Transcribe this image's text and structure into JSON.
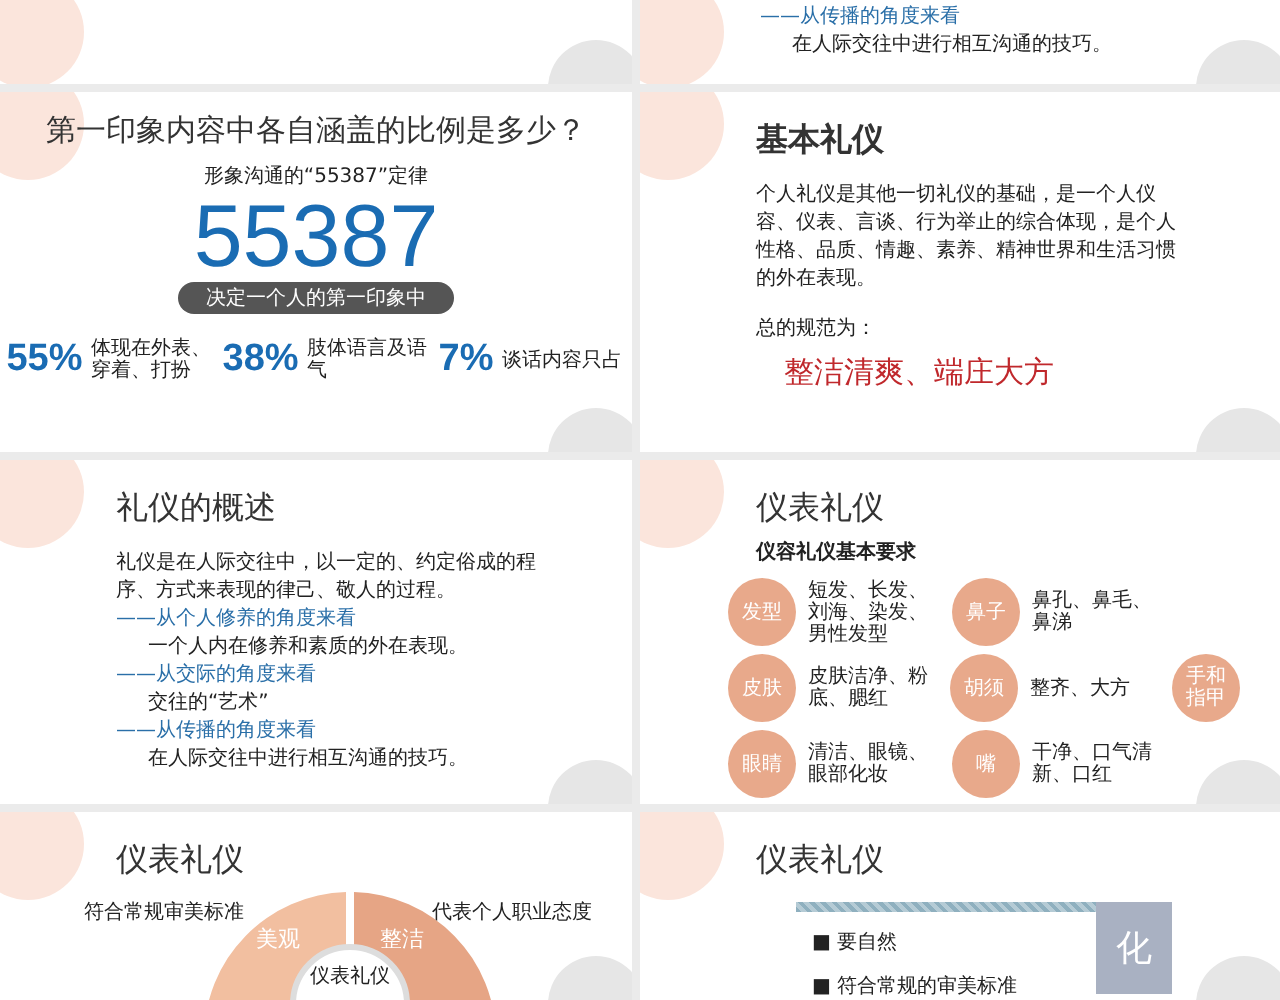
{
  "slides": [
    {
      "kind": "blank"
    },
    {
      "kind": "tail",
      "items": [
        {
          "kind": "heading",
          "text": "——从传播的角度来看"
        },
        {
          "kind": "body",
          "text": "在人际交往中进行相互沟通的技巧。"
        }
      ]
    },
    {
      "kind": "stats",
      "title": "第一印象内容中各自涵盖的比例是多少？",
      "subtitle": "形象沟通的“55387”定律",
      "number": "55387",
      "pill": "决定一个人的第一印象中",
      "stats": [
        {
          "value": "55%",
          "text": "体现在外表、穿着、打扮"
        },
        {
          "value": "38%",
          "text": "肢体语言及语气"
        },
        {
          "value": "7%",
          "text": "谈话内容只占"
        }
      ]
    },
    {
      "kind": "basic",
      "title": "基本礼仪",
      "paragraph": "个人礼仪是其他一切礼仪的基础，是一个人仪容、仪表、言谈、行为举止的综合体现，是个人性格、品质、情趣、素养、精神世界和生活习惯的外在表现。",
      "label": "总的规范为：",
      "emphasis": "整洁清爽、端庄大方"
    },
    {
      "kind": "overview",
      "title": "礼仪的概述",
      "paragraph": "礼仪是在人际交往中，以一定的、约定俗成的程序、方式来表现的律己、敬人的过程。",
      "items": [
        {
          "kind": "heading",
          "text": "——从个人修养的角度来看"
        },
        {
          "kind": "body",
          "text": "一个人内在修养和素质的外在表现。"
        },
        {
          "kind": "heading",
          "text": "——从交际的角度来看"
        },
        {
          "kind": "body",
          "text": "交往的“艺术”"
        },
        {
          "kind": "heading",
          "text": "——从传播的角度来看"
        },
        {
          "kind": "body",
          "text": "在人际交往中进行相互沟通的技巧。"
        }
      ]
    },
    {
      "kind": "grid",
      "title": "仪表礼仪",
      "subtitle": "仪容礼仪基本要求",
      "rows": [
        [
          {
            "kind": "circle",
            "text": "发型"
          },
          {
            "kind": "note",
            "text": "短发、长发、刘海、染发、男性发型"
          },
          {
            "kind": "circle",
            "text": "鼻子"
          },
          {
            "kind": "note",
            "text": "鼻孔、鼻毛、鼻涕"
          }
        ],
        [
          {
            "kind": "circle",
            "text": "皮肤"
          },
          {
            "kind": "note",
            "text": "皮肤洁净、粉底、腮红"
          },
          {
            "kind": "circle",
            "text": "胡须"
          },
          {
            "kind": "note",
            "text": "整齐、大方"
          },
          {
            "kind": "circle",
            "text": "手和指甲"
          }
        ],
        [
          {
            "kind": "circle",
            "text": "眼睛"
          },
          {
            "kind": "note",
            "text": "清洁、眼镜、眼部化妆"
          },
          {
            "kind": "circle",
            "text": "嘴"
          },
          {
            "kind": "note",
            "text": "干净、口气清新、口红"
          }
        ]
      ]
    },
    {
      "kind": "donut",
      "title": "仪表礼仪",
      "left": "符合常规审美标准",
      "right": "代表个人职业态度",
      "segments": [
        "美观",
        "整洁"
      ],
      "center": "仪表礼仪"
    },
    {
      "kind": "list",
      "title": "仪表礼仪",
      "items": [
        "■ 要自然",
        "■ 符合常规的审美标准"
      ],
      "block": "化"
    }
  ]
}
